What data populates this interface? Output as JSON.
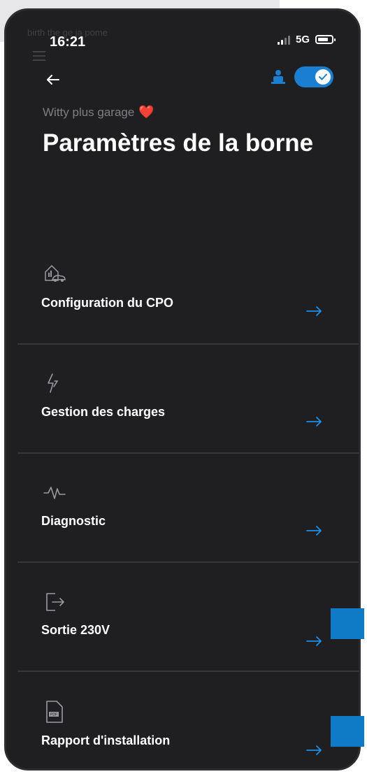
{
  "background_overlay": {
    "ghost_text": "birth the ge ja pome"
  },
  "status_bar": {
    "time": "16:21",
    "network": "5G"
  },
  "header": {
    "subtitle": "Witty plus garage",
    "subtitle_emoji": "❤️",
    "title": "Paramètres de la borne",
    "toggle_on": true
  },
  "menu": {
    "items": [
      {
        "label": "Configuration du CPO",
        "icon": "cpo-config-icon"
      },
      {
        "label": "Gestion des charges",
        "icon": "lightning-icon"
      },
      {
        "label": "Diagnostic",
        "icon": "pulse-icon"
      },
      {
        "label": "Sortie 230V",
        "icon": "exit-icon"
      },
      {
        "label": "Rapport d'installation",
        "icon": "pdf-file-icon"
      }
    ]
  },
  "colors": {
    "accent": "#1a7fd1",
    "background": "#1f1f21",
    "arrow": "#1e8ee6",
    "overlay_square": "#0f7bc6"
  }
}
